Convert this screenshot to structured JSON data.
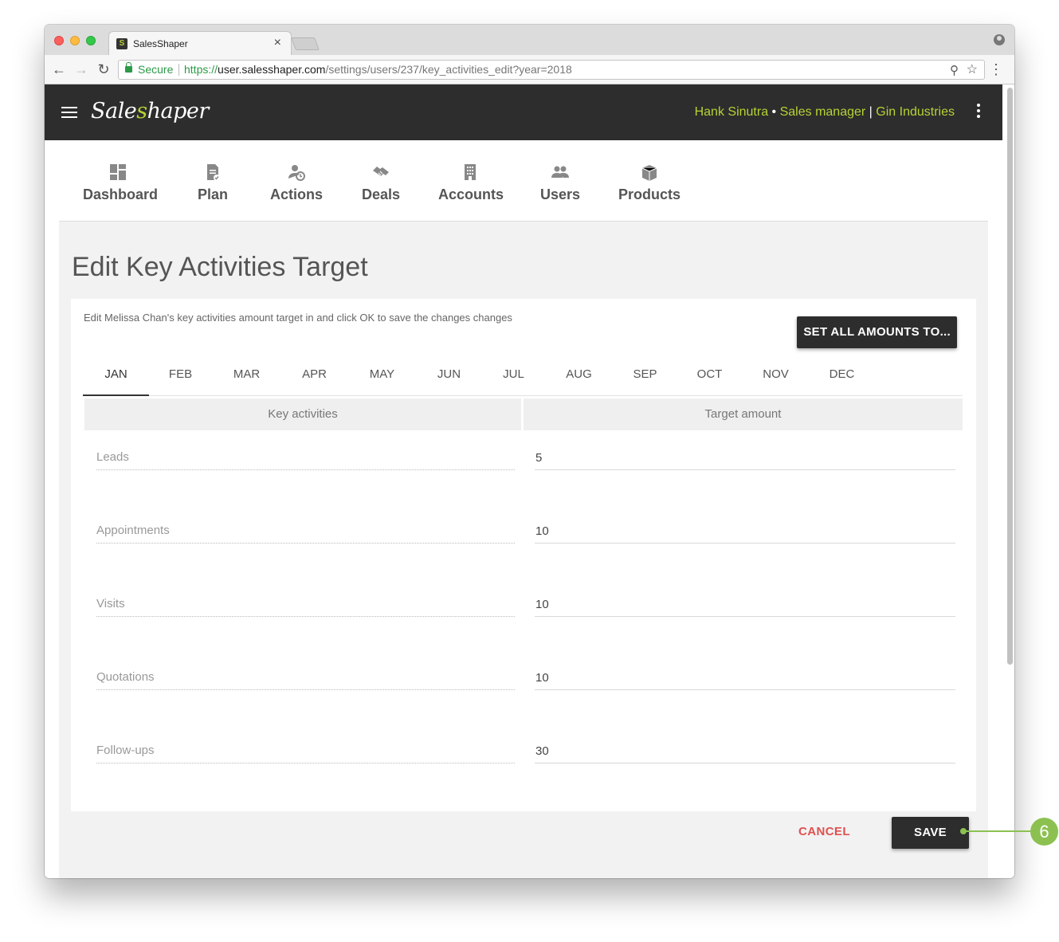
{
  "browser": {
    "tab_title": "SalesShaper",
    "tab_close": "×",
    "secure_label": "Secure",
    "url_scheme": "https://",
    "url_host": "user.salesshaper.com",
    "url_path": "/settings/users/237/key_activities_edit?year=2018"
  },
  "app": {
    "logo_prefix": "Sale",
    "logo_mark": "s",
    "logo_suffix": "haper",
    "user_name": "Hank Sinutra",
    "user_role": "Sales manager",
    "company": "Gin Industries"
  },
  "nav": {
    "items": [
      {
        "label": "Dashboard",
        "icon": "dashboard-icon"
      },
      {
        "label": "Plan",
        "icon": "plan-icon"
      },
      {
        "label": "Actions",
        "icon": "actions-icon"
      },
      {
        "label": "Deals",
        "icon": "deals-icon"
      },
      {
        "label": "Accounts",
        "icon": "accounts-icon"
      },
      {
        "label": "Users",
        "icon": "users-icon"
      },
      {
        "label": "Products",
        "icon": "products-icon"
      }
    ]
  },
  "page": {
    "title": "Edit Key Activities Target",
    "description": "Edit Melissa Chan's key activities amount target in and click OK to save the changes changes",
    "set_all_label": "SET ALL AMOUNTS TO...",
    "months": [
      "JAN",
      "FEB",
      "MAR",
      "APR",
      "MAY",
      "JUN",
      "JUL",
      "AUG",
      "SEP",
      "OCT",
      "NOV",
      "DEC"
    ],
    "active_month": "JAN",
    "table": {
      "col_activities": "Key activities",
      "col_target": "Target amount",
      "rows": [
        {
          "activity": "Leads",
          "target": "5"
        },
        {
          "activity": "Appointments",
          "target": "10"
        },
        {
          "activity": "Visits",
          "target": "10"
        },
        {
          "activity": "Quotations",
          "target": "10"
        },
        {
          "activity": "Follow-ups",
          "target": "30"
        }
      ]
    },
    "cancel_label": "CANCEL",
    "save_label": "SAVE"
  },
  "callout": {
    "number": "6"
  },
  "colors": {
    "accent": "#b5d334",
    "appbar": "#2d2d2d",
    "cancel": "#e05050",
    "callout": "#8cc152"
  }
}
